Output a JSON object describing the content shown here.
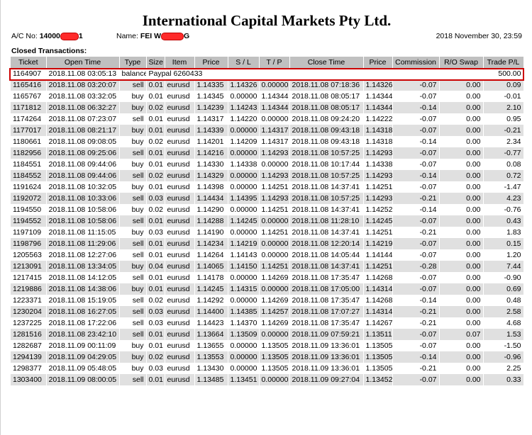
{
  "title": "International Capital Markets Pty Ltd.",
  "account": {
    "label": "A/C No:",
    "value_prefix": "14000",
    "value_suffix": "1"
  },
  "name": {
    "label": "Name:",
    "value_prefix": "FEI W",
    "value_suffix": "G"
  },
  "report_datetime": "2018 November 30, 23:59",
  "section_title": "Closed Transactions:",
  "colors": {
    "header_bg": "#c0c0c0",
    "row_alt_bg": "#e0e0e0",
    "highlight_border": "#cc0000",
    "redaction": "#ff2a2a"
  },
  "columns": [
    "Ticket",
    "Open Time",
    "Type",
    "Size",
    "Item",
    "Price",
    "S / L",
    "T / P",
    "Close Time",
    "Price",
    "Commission",
    "R/O Swap",
    "Trade P/L"
  ],
  "balance_row": {
    "ticket": "1164907",
    "open_time": "2018.11.08 03:05:13",
    "type": "balance",
    "comment": "Paypal 6260433",
    "trade_pl": "500.00"
  },
  "rows": [
    [
      "1165416",
      "2018.11.08 03:20:07",
      "sell",
      "0.01",
      "eurusd",
      "1.14335",
      "1.14326",
      "0.00000",
      "2018.11.08 07:18:36",
      "1.14326",
      "-0.07",
      "0.00",
      "0.09"
    ],
    [
      "1165767",
      "2018.11.08 03:32:05",
      "buy",
      "0.01",
      "eurusd",
      "1.14345",
      "0.00000",
      "1.14344",
      "2018.11.08 08:05:17",
      "1.14344",
      "-0.07",
      "0.00",
      "-0.01"
    ],
    [
      "1171812",
      "2018.11.08 06:32:27",
      "buy",
      "0.02",
      "eurusd",
      "1.14239",
      "1.14243",
      "1.14344",
      "2018.11.08 08:05:17",
      "1.14344",
      "-0.14",
      "0.00",
      "2.10"
    ],
    [
      "1174264",
      "2018.11.08 07:23:07",
      "sell",
      "0.01",
      "eurusd",
      "1.14317",
      "1.14220",
      "0.00000",
      "2018.11.08 09:24:20",
      "1.14222",
      "-0.07",
      "0.00",
      "0.95"
    ],
    [
      "1177017",
      "2018.11.08 08:21:17",
      "buy",
      "0.01",
      "eurusd",
      "1.14339",
      "0.00000",
      "1.14317",
      "2018.11.08 09:43:18",
      "1.14318",
      "-0.07",
      "0.00",
      "-0.21"
    ],
    [
      "1180661",
      "2018.11.08 09:08:05",
      "buy",
      "0.02",
      "eurusd",
      "1.14201",
      "1.14209",
      "1.14317",
      "2018.11.08 09:43:18",
      "1.14318",
      "-0.14",
      "0.00",
      "2.34"
    ],
    [
      "1182956",
      "2018.11.08 09:25:06",
      "sell",
      "0.01",
      "eurusd",
      "1.14216",
      "0.00000",
      "1.14293",
      "2018.11.08 10:57:25",
      "1.14293",
      "-0.07",
      "0.00",
      "-0.77"
    ],
    [
      "1184551",
      "2018.11.08 09:44:06",
      "buy",
      "0.01",
      "eurusd",
      "1.14330",
      "1.14338",
      "0.00000",
      "2018.11.08 10:17:44",
      "1.14338",
      "-0.07",
      "0.00",
      "0.08"
    ],
    [
      "1184552",
      "2018.11.08 09:44:06",
      "sell",
      "0.02",
      "eurusd",
      "1.14329",
      "0.00000",
      "1.14293",
      "2018.11.08 10:57:25",
      "1.14293",
      "-0.14",
      "0.00",
      "0.72"
    ],
    [
      "1191624",
      "2018.11.08 10:32:05",
      "buy",
      "0.01",
      "eurusd",
      "1.14398",
      "0.00000",
      "1.14251",
      "2018.11.08 14:37:41",
      "1.14251",
      "-0.07",
      "0.00",
      "-1.47"
    ],
    [
      "1192072",
      "2018.11.08 10:33:06",
      "sell",
      "0.03",
      "eurusd",
      "1.14434",
      "1.14395",
      "1.14293",
      "2018.11.08 10:57:25",
      "1.14293",
      "-0.21",
      "0.00",
      "4.23"
    ],
    [
      "1194550",
      "2018.11.08 10:58:06",
      "buy",
      "0.02",
      "eurusd",
      "1.14290",
      "0.00000",
      "1.14251",
      "2018.11.08 14:37:41",
      "1.14252",
      "-0.14",
      "0.00",
      "-0.76"
    ],
    [
      "1194552",
      "2018.11.08 10:58:06",
      "sell",
      "0.01",
      "eurusd",
      "1.14288",
      "1.14245",
      "0.00000",
      "2018.11.08 11:28:10",
      "1.14245",
      "-0.07",
      "0.00",
      "0.43"
    ],
    [
      "1197109",
      "2018.11.08 11:15:05",
      "buy",
      "0.03",
      "eurusd",
      "1.14190",
      "0.00000",
      "1.14251",
      "2018.11.08 14:37:41",
      "1.14251",
      "-0.21",
      "0.00",
      "1.83"
    ],
    [
      "1198796",
      "2018.11.08 11:29:06",
      "sell",
      "0.01",
      "eurusd",
      "1.14234",
      "1.14219",
      "0.00000",
      "2018.11.08 12:20:14",
      "1.14219",
      "-0.07",
      "0.00",
      "0.15"
    ],
    [
      "1205563",
      "2018.11.08 12:27:06",
      "sell",
      "0.01",
      "eurusd",
      "1.14264",
      "1.14143",
      "0.00000",
      "2018.11.08 14:05:44",
      "1.14144",
      "-0.07",
      "0.00",
      "1.20"
    ],
    [
      "1213091",
      "2018.11.08 13:34:05",
      "buy",
      "0.04",
      "eurusd",
      "1.14065",
      "1.14150",
      "1.14251",
      "2018.11.08 14:37:41",
      "1.14251",
      "-0.28",
      "0.00",
      "7.44"
    ],
    [
      "1217415",
      "2018.11.08 14:12:05",
      "sell",
      "0.01",
      "eurusd",
      "1.14178",
      "0.00000",
      "1.14269",
      "2018.11.08 17:35:47",
      "1.14268",
      "-0.07",
      "0.00",
      "-0.90"
    ],
    [
      "1219886",
      "2018.11.08 14:38:06",
      "buy",
      "0.01",
      "eurusd",
      "1.14245",
      "1.14315",
      "0.00000",
      "2018.11.08 17:05:00",
      "1.14314",
      "-0.07",
      "0.00",
      "0.69"
    ],
    [
      "1223371",
      "2018.11.08 15:19:05",
      "sell",
      "0.02",
      "eurusd",
      "1.14292",
      "0.00000",
      "1.14269",
      "2018.11.08 17:35:47",
      "1.14268",
      "-0.14",
      "0.00",
      "0.48"
    ],
    [
      "1230204",
      "2018.11.08 16:27:05",
      "sell",
      "0.03",
      "eurusd",
      "1.14400",
      "1.14385",
      "1.14257",
      "2018.11.08 17:07:27",
      "1.14314",
      "-0.21",
      "0.00",
      "2.58"
    ],
    [
      "1237225",
      "2018.11.08 17:22:06",
      "sell",
      "0.03",
      "eurusd",
      "1.14423",
      "1.14370",
      "1.14269",
      "2018.11.08 17:35:47",
      "1.14267",
      "-0.21",
      "0.00",
      "4.68"
    ],
    [
      "1281516",
      "2018.11.08 23:42:10",
      "sell",
      "0.01",
      "eurusd",
      "1.13664",
      "1.13509",
      "0.00000",
      "2018.11.09 07:59:21",
      "1.13511",
      "-0.07",
      "0.07",
      "1.53"
    ],
    [
      "1282687",
      "2018.11.09 00:11:09",
      "buy",
      "0.01",
      "eurusd",
      "1.13655",
      "0.00000",
      "1.13505",
      "2018.11.09 13:36:01",
      "1.13505",
      "-0.07",
      "0.00",
      "-1.50"
    ],
    [
      "1294139",
      "2018.11.09 04:29:05",
      "buy",
      "0.02",
      "eurusd",
      "1.13553",
      "0.00000",
      "1.13505",
      "2018.11.09 13:36:01",
      "1.13505",
      "-0.14",
      "0.00",
      "-0.96"
    ],
    [
      "1298377",
      "2018.11.09 05:48:05",
      "buy",
      "0.03",
      "eurusd",
      "1.13430",
      "0.00000",
      "1.13505",
      "2018.11.09 13:36:01",
      "1.13505",
      "-0.21",
      "0.00",
      "2.25"
    ],
    [
      "1303400",
      "2018.11.09 08:00:05",
      "sell",
      "0.01",
      "eurusd",
      "1.13485",
      "1.13451",
      "0.00000",
      "2018.11.09 09:27:04",
      "1.13452",
      "-0.07",
      "0.00",
      "0.33"
    ]
  ]
}
